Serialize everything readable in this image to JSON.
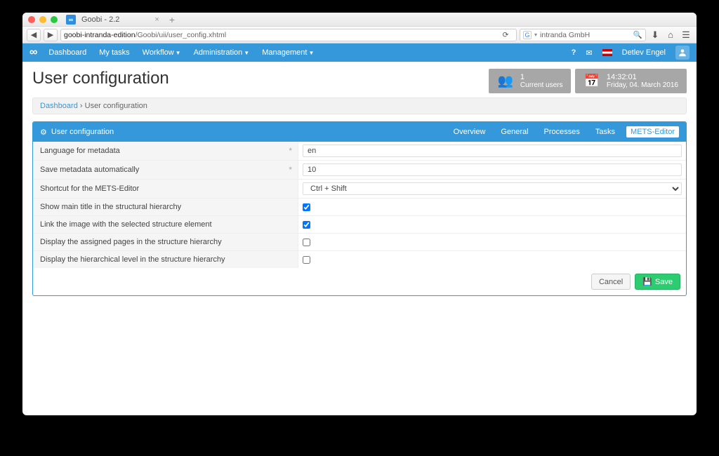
{
  "browser": {
    "tab_title": "Goobi - 2.2",
    "url_host": "goobi-intranda-edition",
    "url_path": "/Goobi/uii/user_config.xhtml",
    "search_value": "intranda GmbH"
  },
  "appbar": {
    "menu": [
      "Dashboard",
      "My tasks",
      "Workflow",
      "Administration",
      "Management"
    ],
    "menu_has_dropdown": [
      false,
      false,
      true,
      true,
      true
    ],
    "help": "?",
    "user": "Detlev Engel"
  },
  "page": {
    "title": "User configuration",
    "breadcrumb": {
      "root": "Dashboard",
      "sep": "›",
      "current": "User configuration"
    }
  },
  "widgets": {
    "users": {
      "count": "1",
      "label": "Current users"
    },
    "clock": {
      "time": "14:32:01",
      "date": "Friday, 04. March 2016"
    }
  },
  "panel": {
    "title": "User configuration",
    "tabs": [
      "Overview",
      "General",
      "Processes",
      "Tasks",
      "METS-Editor"
    ],
    "active_tab": "METS-Editor",
    "rows": [
      {
        "label": "Language for metadata",
        "required": true,
        "type": "text",
        "value": "en"
      },
      {
        "label": "Save metadata automatically",
        "required": true,
        "type": "text",
        "value": "10"
      },
      {
        "label": "Shortcut for the METS-Editor",
        "required": false,
        "type": "select",
        "value": "Ctrl + Shift"
      },
      {
        "label": "Show main title in the structural hierarchy",
        "required": false,
        "type": "checkbox",
        "value": true
      },
      {
        "label": "Link the image with the selected structure element",
        "required": false,
        "type": "checkbox",
        "value": true
      },
      {
        "label": "Display the assigned pages in the structure hierarchy",
        "required": false,
        "type": "checkbox",
        "value": false
      },
      {
        "label": "Display the hierarchical level in the structure hierarchy",
        "required": false,
        "type": "checkbox",
        "value": false
      }
    ],
    "buttons": {
      "cancel": "Cancel",
      "save": "Save"
    }
  }
}
